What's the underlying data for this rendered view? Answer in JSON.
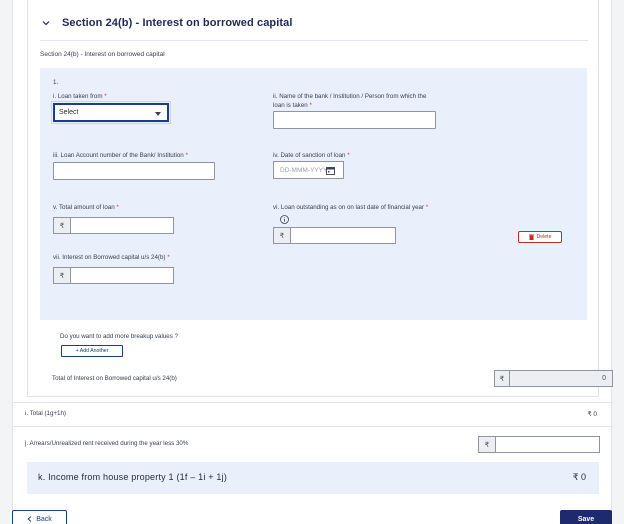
{
  "section": {
    "title": "Section 24(b) - Interest on borrowed capital",
    "subtitle": "Section 24(b) - Interest on borrowed capital"
  },
  "entry": {
    "index": "1.",
    "loan_taken_from_label": "i. Loan taken from",
    "loan_taken_from_value": "Select",
    "bank_name_label_line1": "ii. Name of the bank / Institution / Person from which the",
    "bank_name_label_line2": "loan is taken",
    "account_number_label": "iii. Loan Account number of the Bank/ Institution",
    "sanction_date_label": "iv. Date of sanction of loan",
    "sanction_date_placeholder": "DD-MMM-YYYY",
    "total_loan_label": "v. Total amount of loan",
    "outstanding_label": "vi. Loan outstanding as on on last date of financial year",
    "interest_label": "vii. Interest on Borrowed capital u/s 24(b)",
    "currency_symbol": "₹",
    "delete_label": "Delete",
    "required_mark": "*"
  },
  "breakup": {
    "question": "Do you want to add more breakup values ?",
    "add_another_label": "+ Add Another"
  },
  "total_interest": {
    "label": "Total of Interest on Borrowed capital u/s 24(b)",
    "currency_symbol": "₹",
    "value": "0"
  },
  "rows": {
    "total_label": "i. Total (1g+1h)",
    "total_value": "₹ 0",
    "arrears_label": "j. Arrears/Unrealized rent received during the year less 30%",
    "arrears_currency": "₹"
  },
  "income": {
    "label": "k. Income from house property 1 (1f – 1i + 1j)",
    "value": "₹ 0"
  },
  "footer": {
    "back_label": "Back",
    "save_label": "Save"
  },
  "colors": {
    "brand": "#1e2a6e",
    "panel": "#e9f0fb",
    "danger": "#c62828"
  }
}
